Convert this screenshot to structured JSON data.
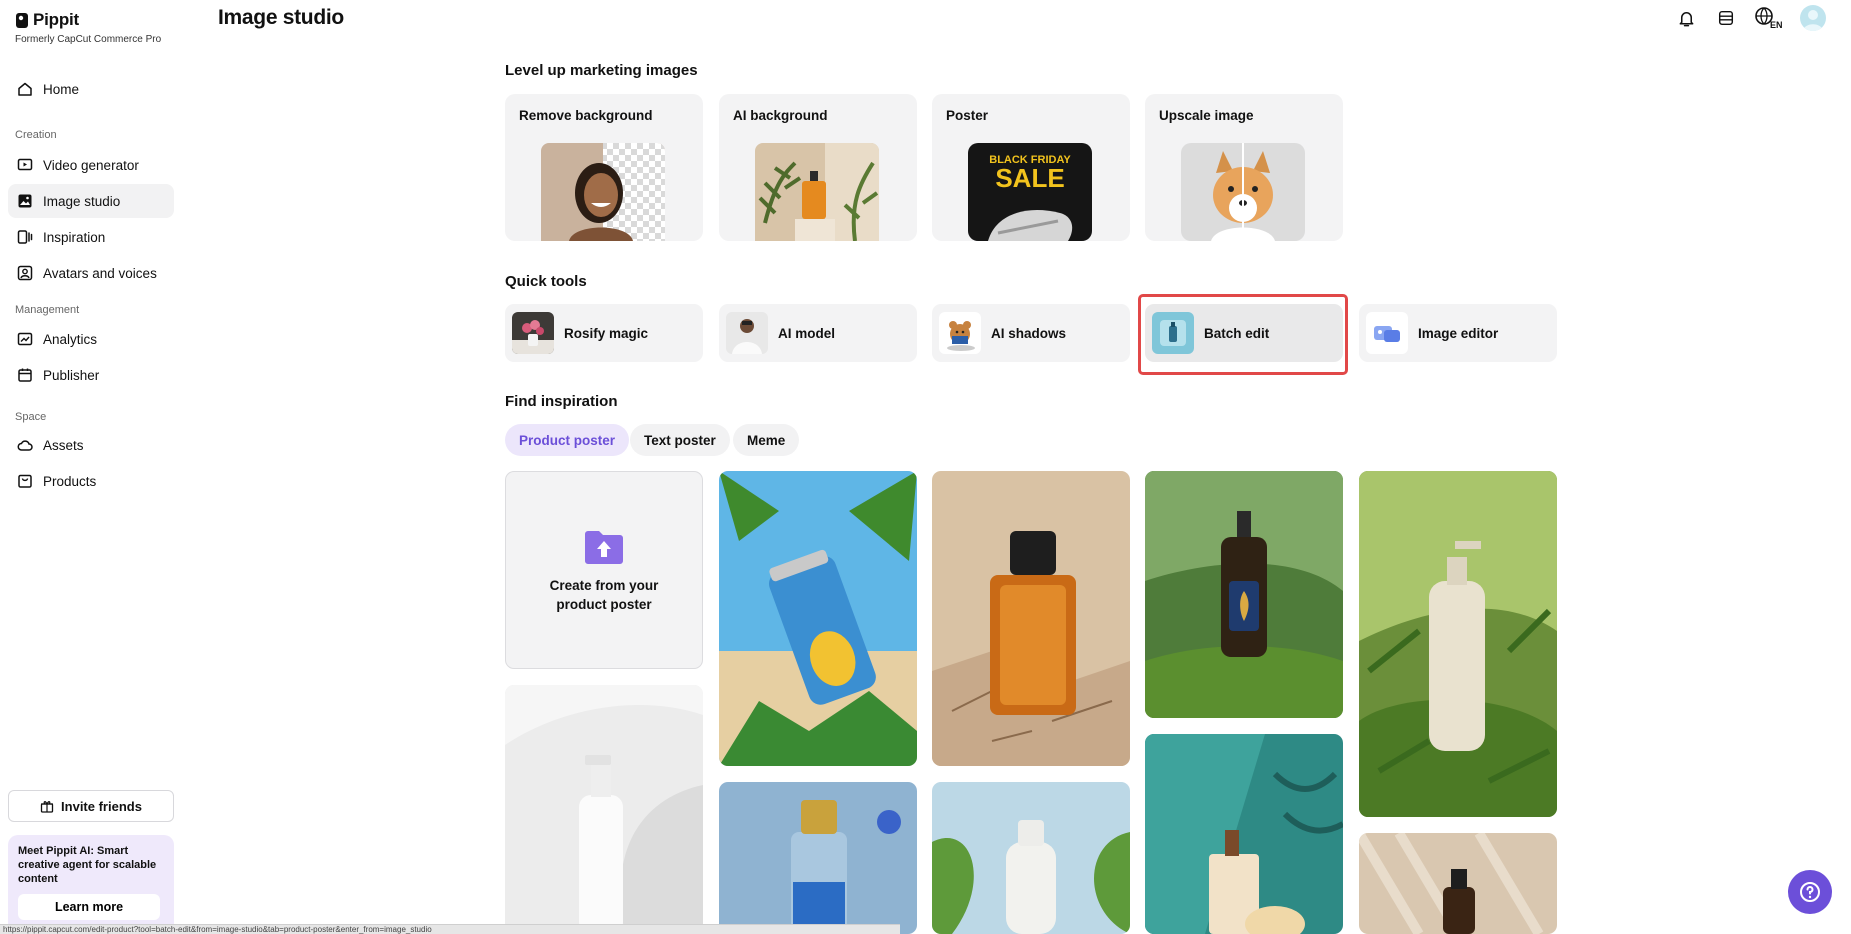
{
  "brand": {
    "name": "Pippit",
    "subtitle": "Formerly CapCut Commerce Pro"
  },
  "header": {
    "title": "Image studio",
    "language_badge": "EN"
  },
  "sidebar": {
    "home": "Home",
    "sections": {
      "creation": "Creation",
      "management": "Management",
      "space": "Space"
    },
    "items": {
      "video_generator": "Video generator",
      "image_studio": "Image studio",
      "inspiration": "Inspiration",
      "avatars": "Avatars and voices",
      "analytics": "Analytics",
      "publisher": "Publisher",
      "assets": "Assets",
      "products": "Products"
    },
    "invite": "Invite friends",
    "promo": {
      "text": "Meet Pippit AI: Smart creative agent for scalable content",
      "button": "Learn more"
    }
  },
  "main": {
    "marketing_title": "Level up marketing images",
    "features": [
      {
        "label": "Remove background"
      },
      {
        "label": "AI background"
      },
      {
        "label": "Poster",
        "art_text_1": "BLACK FRIDAY",
        "art_text_2": "SALE"
      },
      {
        "label": "Upscale image"
      }
    ],
    "quick_tools_title": "Quick tools",
    "tools": [
      {
        "label": "Rosify magic"
      },
      {
        "label": "AI model"
      },
      {
        "label": "AI shadows"
      },
      {
        "label": "Batch edit"
      },
      {
        "label": "Image editor"
      }
    ],
    "inspiration_title": "Find inspiration",
    "chips": [
      "Product poster",
      "Text poster",
      "Meme"
    ],
    "create_tile": "Create from your product poster"
  },
  "status_url": "https://pippit.capcut.com/edit-product?tool=batch-edit&from=image-studio&tab=product-poster&enter_from=image_studio"
}
